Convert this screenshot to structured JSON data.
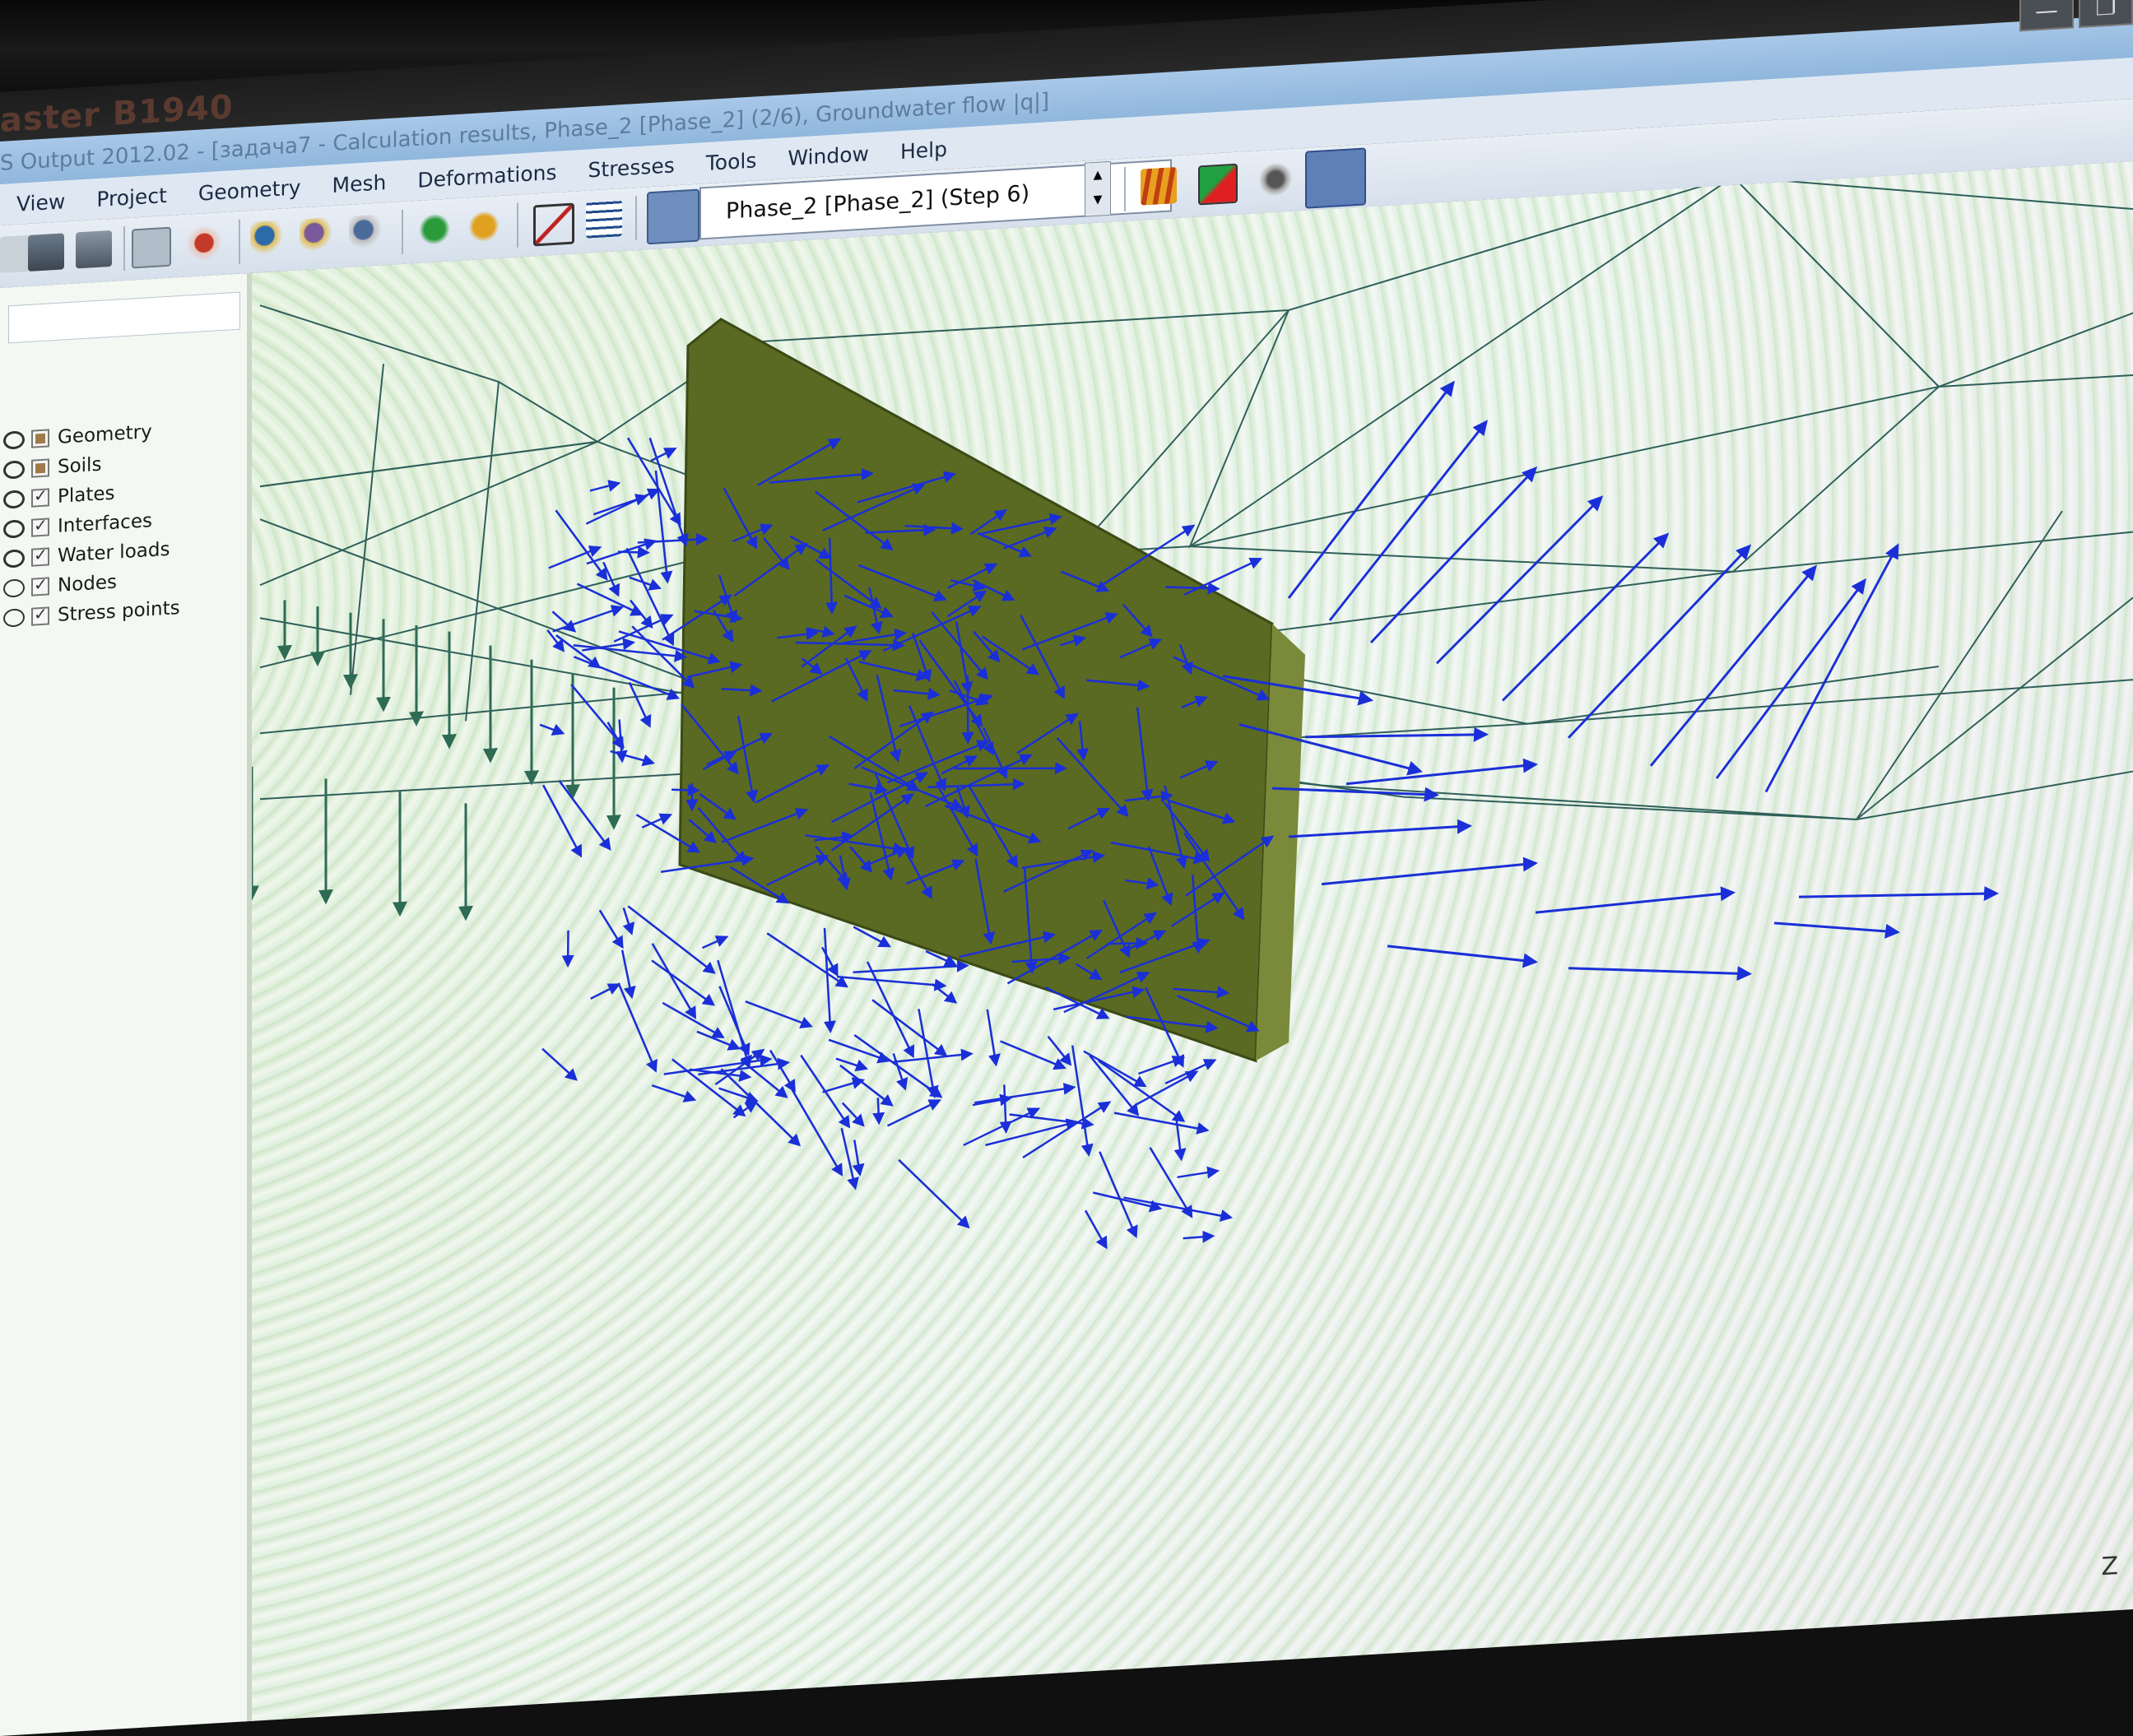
{
  "app": {
    "watermark": "aster B1940",
    "window_title": "S Output 2012.02 - [задача7 - Calculation results, Phase_2 [Phase_2] (2/6), Groundwater flow |q|]"
  },
  "window_controls": {
    "minimize": "—",
    "restore": "❐"
  },
  "menu": [
    "View",
    "Project",
    "Geometry",
    "Mesh",
    "Deformations",
    "Stresses",
    "Tools",
    "Window",
    "Help"
  ],
  "toolbar": {
    "phase_select_value": "Phase_2 [Phase_2] (Step 6)",
    "icons": [
      "new-icon",
      "print-icon",
      "print-preview-icon",
      "chart-icon",
      "pan-icon",
      "zoom-in-icon",
      "zoom-out-icon",
      "zoom-window-icon",
      "move-icon",
      "rotate-icon",
      "scale-icon",
      "table-icon",
      "arrows-icon",
      "shadings-icon",
      "contours-icon",
      "flow-icon",
      "vectors-icon"
    ]
  },
  "layers": [
    {
      "label": "Geometry",
      "visible": true,
      "checked": "filled"
    },
    {
      "label": "Soils",
      "visible": true,
      "checked": "filled"
    },
    {
      "label": "Plates",
      "visible": true,
      "checked": "checked"
    },
    {
      "label": "Interfaces",
      "visible": true,
      "checked": "checked"
    },
    {
      "label": "Water loads",
      "visible": true,
      "checked": "checked"
    },
    {
      "label": "Nodes",
      "visible": false,
      "checked": "checked"
    },
    {
      "label": "Stress points",
      "visible": false,
      "checked": "checked"
    }
  ],
  "viewport": {
    "axis_label": "Z",
    "colors": {
      "mesh": "#2f5f5a",
      "flow_arrows": "#1a2fd8",
      "water_load_arrows": "#2e6b55",
      "plate": "#5a6a22"
    }
  }
}
